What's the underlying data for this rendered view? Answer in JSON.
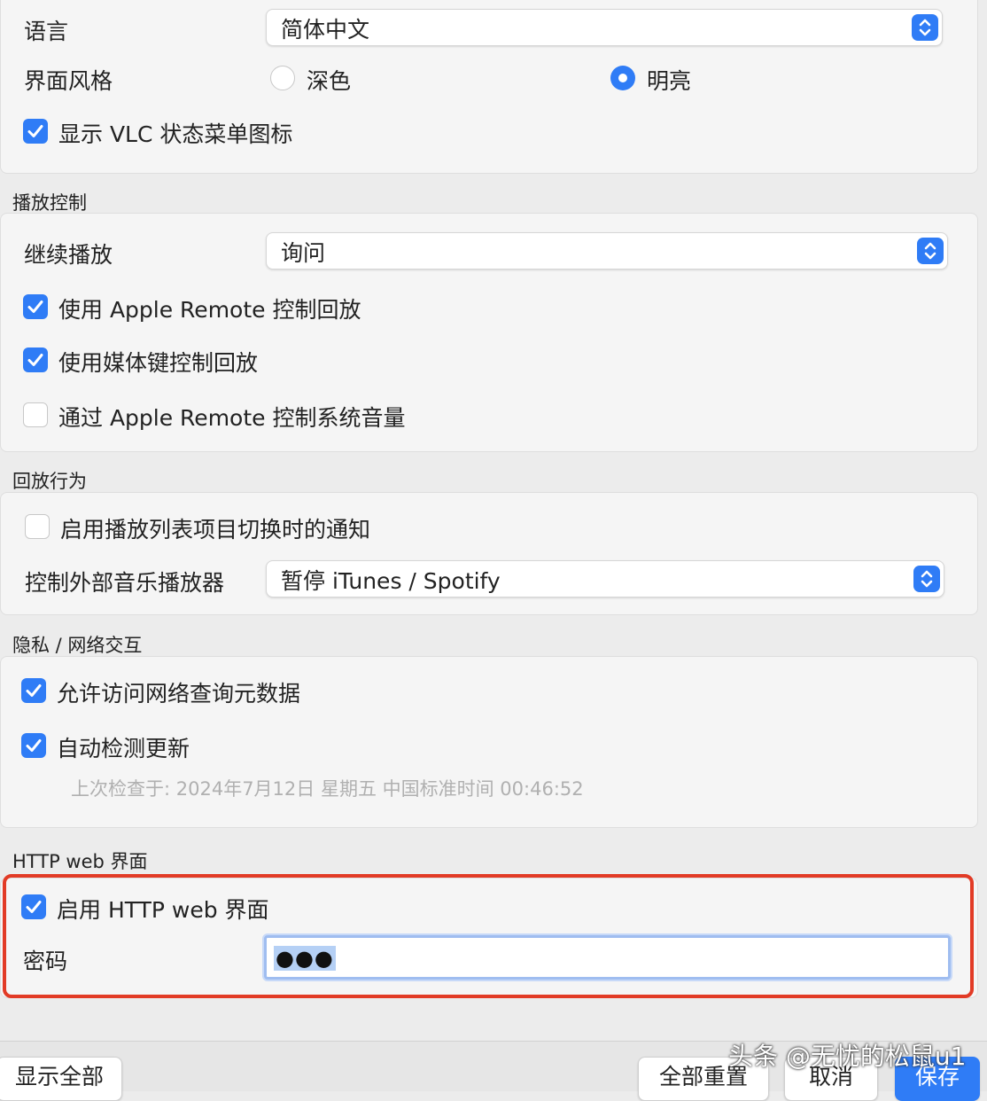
{
  "general": {
    "language_label": "语言",
    "language_value": "简体中文",
    "theme_label": "界面风格",
    "theme_options": [
      "深色",
      "明亮"
    ],
    "theme_selected": "明亮",
    "show_status_icon_label": "显示 VLC 状态菜单图标",
    "show_status_icon_checked": true
  },
  "playback_control": {
    "title": "播放控制",
    "resume_label": "继续播放",
    "resume_value": "询问",
    "apple_remote_label": "使用 Apple Remote 控制回放",
    "apple_remote_checked": true,
    "media_keys_label": "使用媒体键控制回放",
    "media_keys_checked": true,
    "remote_volume_label": "通过 Apple Remote 控制系统音量",
    "remote_volume_checked": false
  },
  "playback_behavior": {
    "title": "回放行为",
    "notify_label": "启用播放列表项目切换时的通知",
    "notify_checked": false,
    "external_player_label": "控制外部音乐播放器",
    "external_player_value": "暂停 iTunes / Spotify"
  },
  "privacy": {
    "title": "隐私 / 网络交互",
    "metadata_label": "允许访问网络查询元数据",
    "metadata_checked": true,
    "auto_update_label": "自动检测更新",
    "auto_update_checked": true,
    "last_check": "上次检查于: 2024年7月12日 星期五 中国标准时间 00:46:52"
  },
  "http": {
    "title": "HTTP web 界面",
    "enable_label": "启用 HTTP web 界面",
    "enable_checked": true,
    "password_label": "密码",
    "password_value": "●●●"
  },
  "buttons": {
    "show_all": "显示全部",
    "reset_all": "全部重置",
    "cancel": "取消",
    "save": "保存"
  },
  "watermark": "头条 @无忧的松鼠u1",
  "colors": {
    "accent": "#2f7cf6",
    "highlight_border": "#e23b26"
  }
}
